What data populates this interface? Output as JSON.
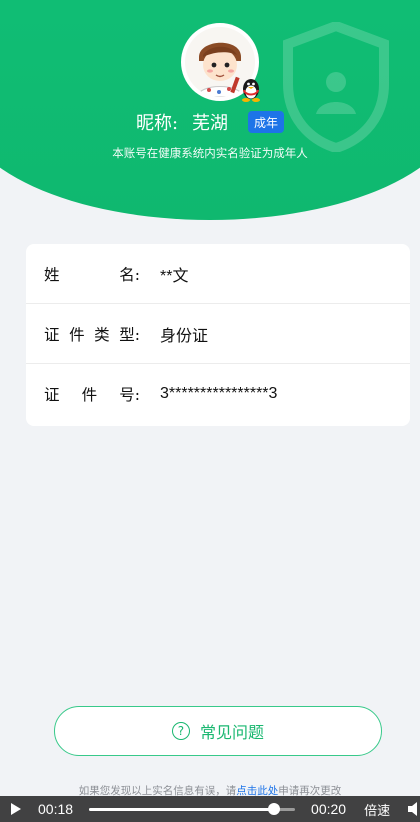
{
  "profile": {
    "nickname_label": "昵称:",
    "nickname": "芜湖",
    "age_badge": "成年",
    "verify_note": "本账号在健康系统内实名验证为成年人"
  },
  "info": {
    "rows": [
      {
        "label_chars": [
          "姓",
          "名:"
        ],
        "value": "**文"
      },
      {
        "label_chars": [
          "证",
          "件",
          "类",
          "型:"
        ],
        "value": "身份证"
      },
      {
        "label_chars": [
          "证",
          "件",
          "号:"
        ],
        "value": "3****************3"
      }
    ]
  },
  "faq": {
    "icon": "help-circle-icon",
    "label": "常见问题"
  },
  "bottom_note": {
    "prefix": "如果您发现以上实名信息有误，请",
    "link": "点击此处",
    "suffix": "申请再次更改"
  },
  "player": {
    "current_time": "00:18",
    "duration": "00:20",
    "progress": 0.9,
    "speed_label": "倍速"
  },
  "colors": {
    "brand_green": "#10bd74",
    "badge_blue": "#1d74e8",
    "faq_green": "#19b770"
  }
}
